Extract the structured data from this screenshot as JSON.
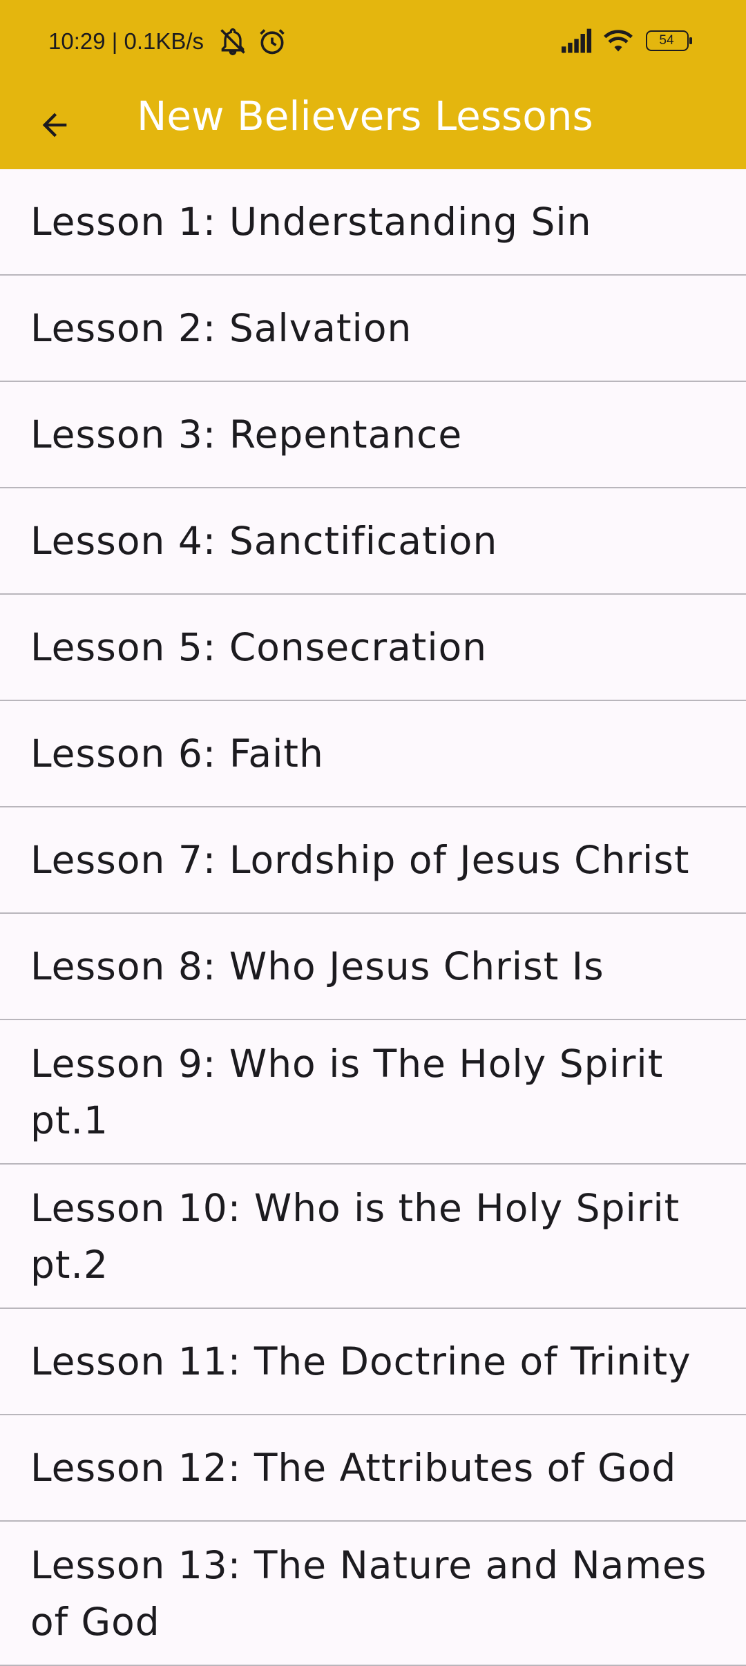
{
  "status_bar": {
    "time_and_speed": "10:29 | 0.1KB/s",
    "icons": [
      "notifications-off-icon",
      "alarm-icon",
      "signal-icon",
      "wifi-icon",
      "battery-icon"
    ],
    "battery_level": "54"
  },
  "app_bar": {
    "title": "New Believers Lessons",
    "back_icon": "arrow-back-icon",
    "background_color": "#e4b60e",
    "title_color": "#ffffff"
  },
  "lessons": [
    {
      "label": "Lesson 1: Understanding Sin"
    },
    {
      "label": "Lesson 2: Salvation"
    },
    {
      "label": "Lesson 3: Repentance"
    },
    {
      "label": "Lesson 4: Sanctification"
    },
    {
      "label": "Lesson 5: Consecration"
    },
    {
      "label": "Lesson 6: Faith"
    },
    {
      "label": "Lesson 7: Lordship of Jesus Christ"
    },
    {
      "label": "Lesson 8: Who Jesus Christ Is"
    },
    {
      "label": "Lesson 9: Who is The Holy Spirit pt.1"
    },
    {
      "label": "Lesson 10: Who is the Holy Spirit pt.2"
    },
    {
      "label": "Lesson 11: The Doctrine of Trinity"
    },
    {
      "label": "Lesson 12: The Attributes of God"
    },
    {
      "label": "Lesson 13: The Nature and Names of God"
    }
  ]
}
